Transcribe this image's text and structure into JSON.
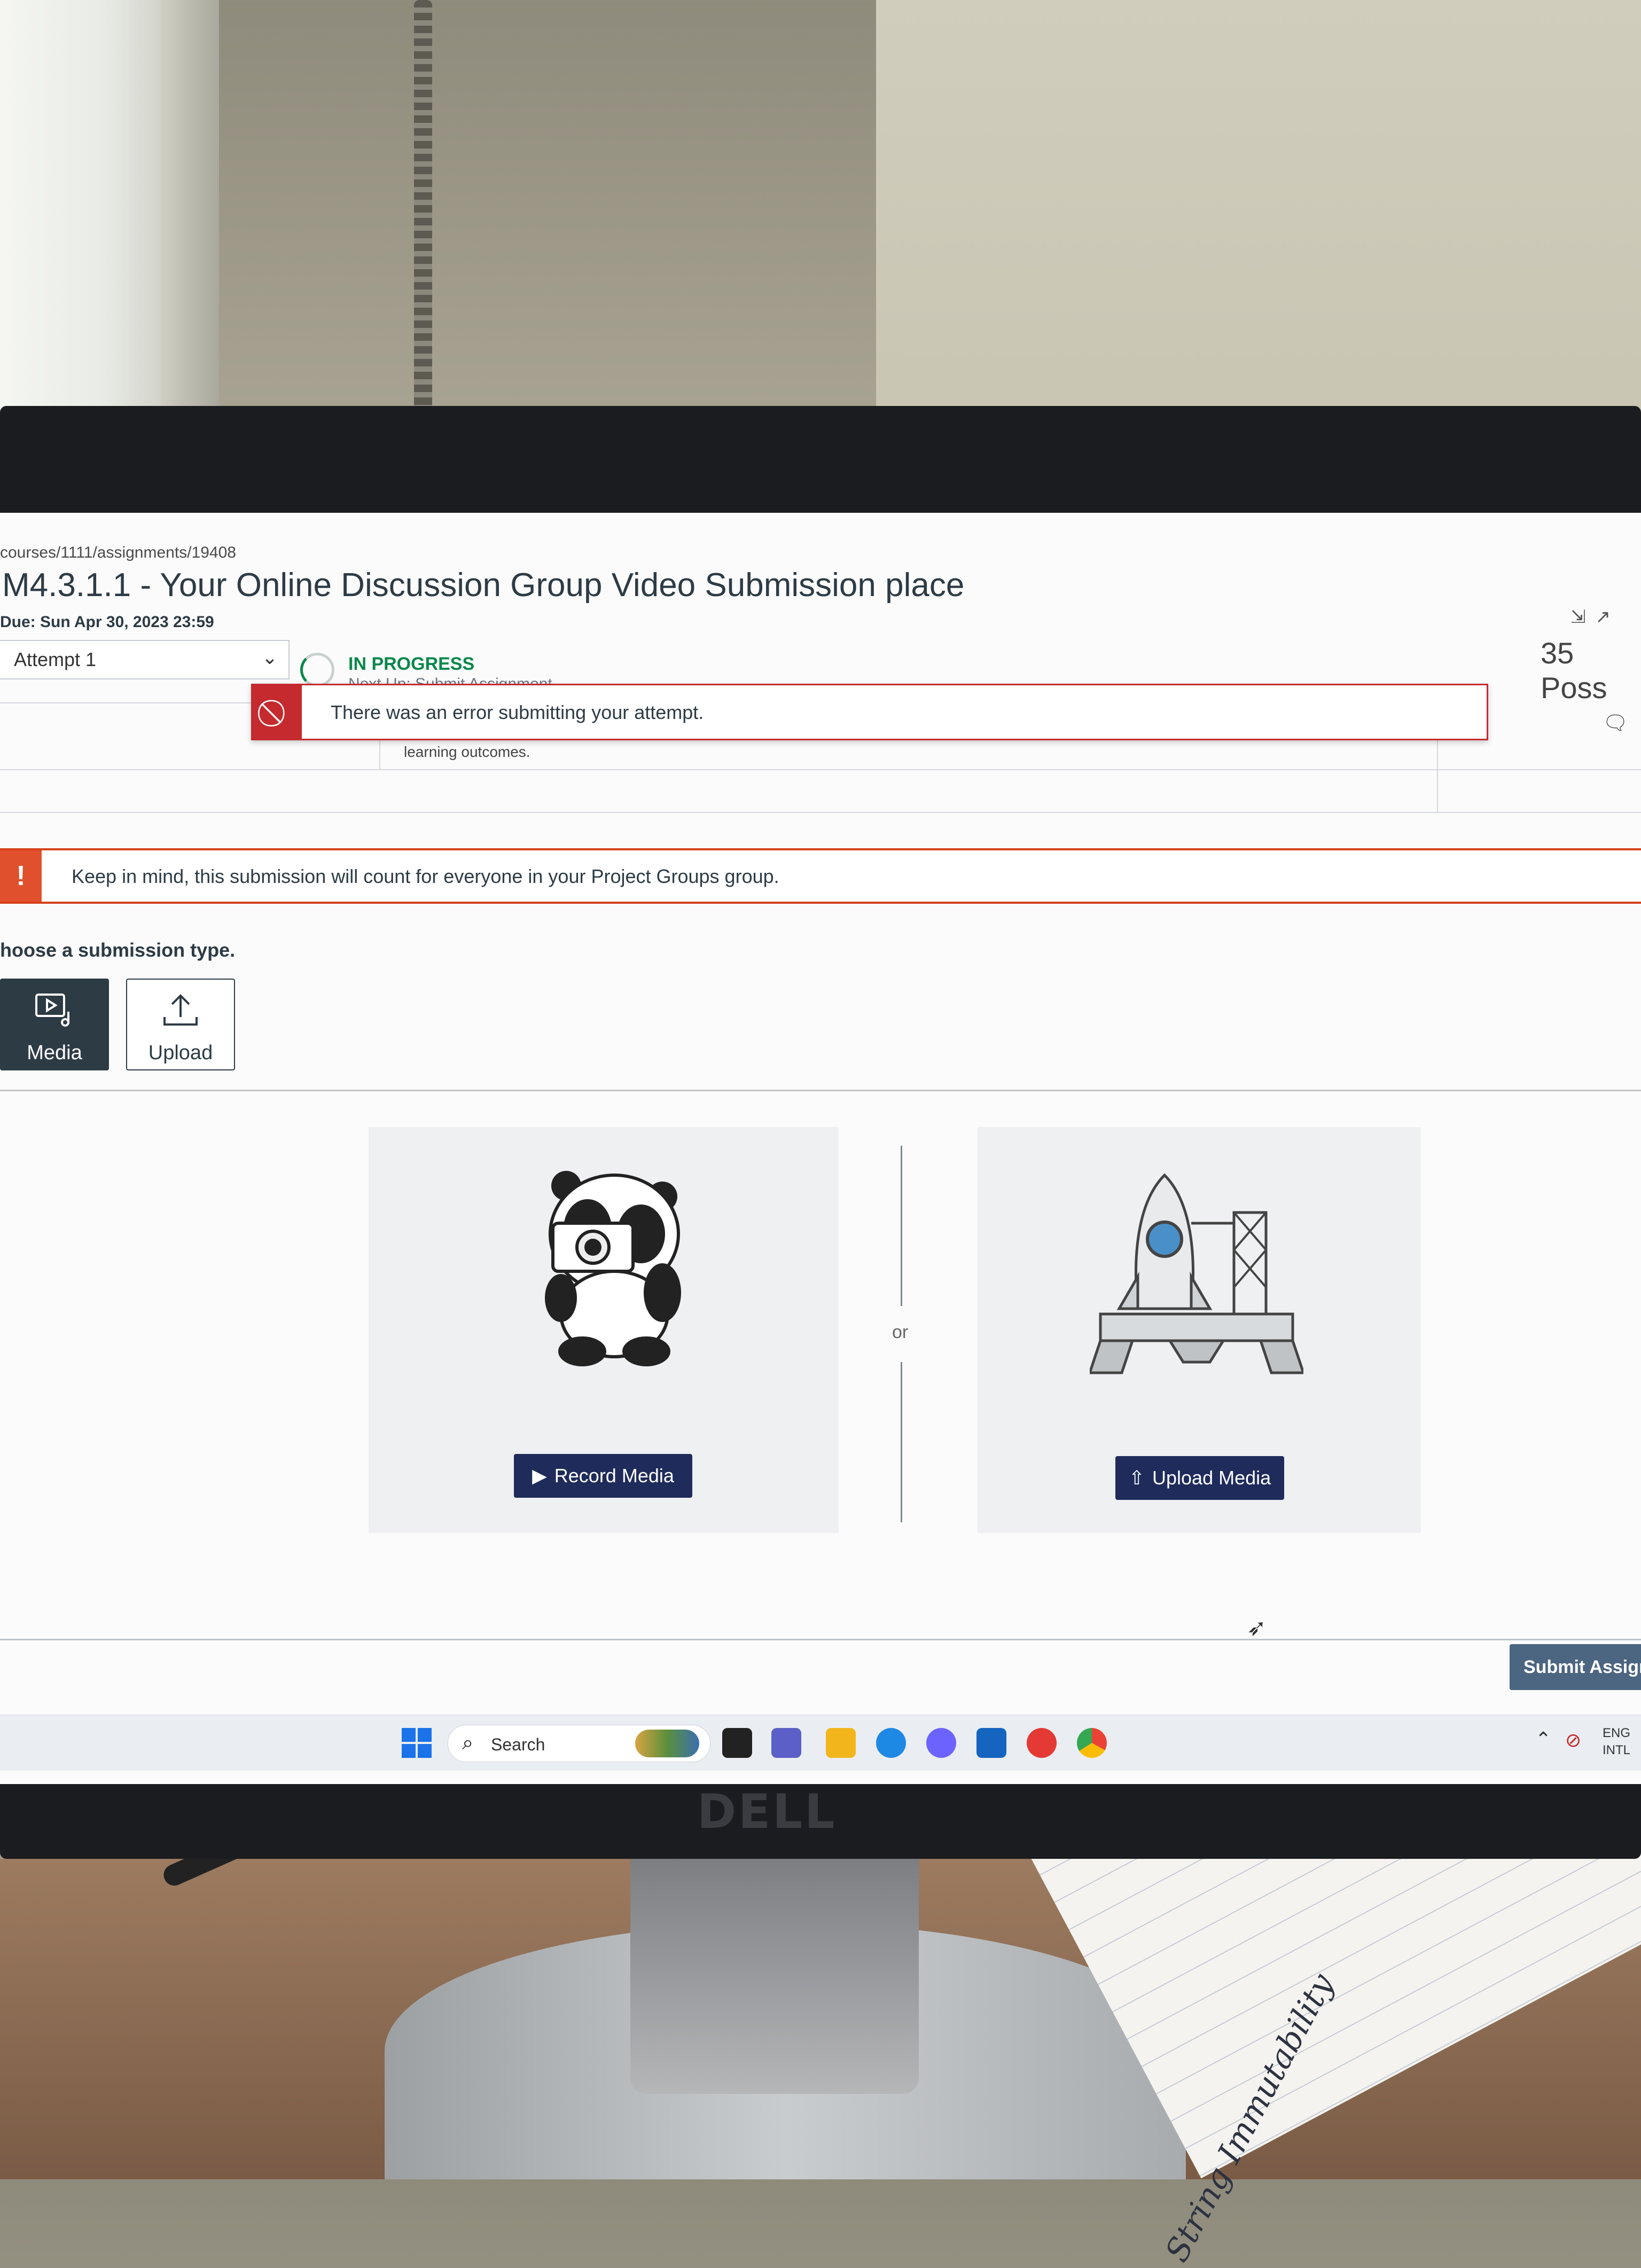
{
  "url": "courses/1111/assignments/19408",
  "assignment": {
    "title": "M4.3.1.1 - Your Online Discussion Group Video Submission place",
    "due": "Due: Sun Apr 30, 2023 23:59",
    "points": "35 Poss"
  },
  "attempt": {
    "selected": "Attempt 1",
    "status": "IN PROGRESS",
    "next_up": "Next Up: Submit Assignment",
    "learning_text": "learning outcomes."
  },
  "error_banner": {
    "text": "There was an error submitting your attempt."
  },
  "group_banner": {
    "icon": "!",
    "text": "Keep in mind, this submission will count for everyone in your Project Groups group."
  },
  "submission": {
    "prompt": "hoose a submission type.",
    "types": [
      {
        "label": "Media",
        "icon": "media-icon",
        "selected": true
      },
      {
        "label": "Upload",
        "icon": "upload-icon",
        "selected": false
      }
    ],
    "or_text": "or",
    "record_button": "Record Media",
    "upload_button": "Upload Media",
    "submit_button": "Submit Assignm"
  },
  "taskbar": {
    "search_label": "Search",
    "lang_line1": "ENG",
    "lang_line2": "INTL"
  },
  "bezel": {
    "brand": "DELL"
  },
  "note_paper": {
    "handwriting": "String Immutability"
  },
  "colors": {
    "error_red": "#c52a2e",
    "warning_orange": "#e0502c",
    "success_green": "#0b874b",
    "primary_dark": "#2d3b45",
    "button_navy": "#1e2b5b",
    "submit_slate": "#4c6580"
  }
}
